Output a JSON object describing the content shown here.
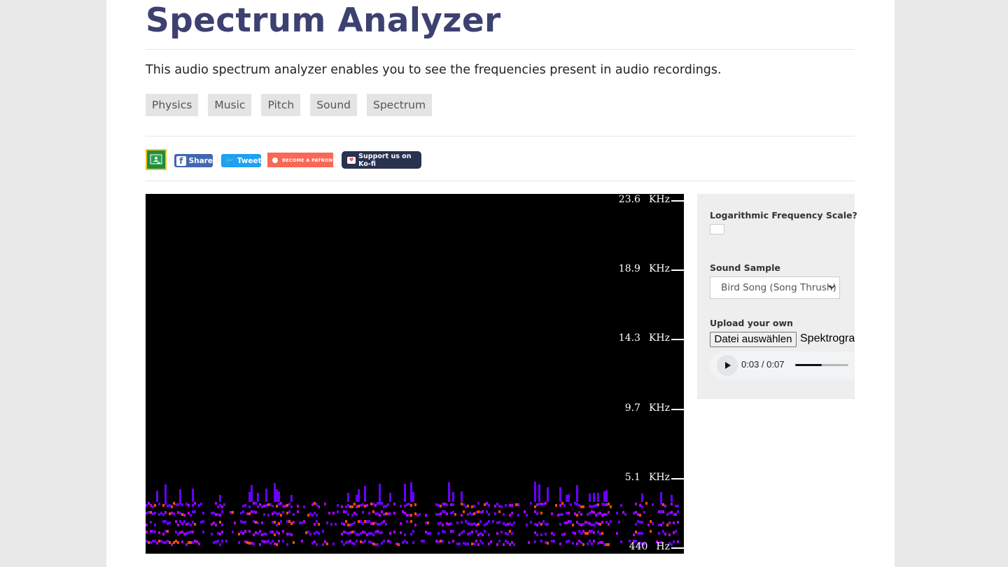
{
  "page": {
    "title": "Spectrum Analyzer",
    "description": "This audio spectrum analyzer enables you to see the frequencies present in audio recordings.",
    "tags": [
      "Physics",
      "Music",
      "Pitch",
      "Sound",
      "Spectrum"
    ]
  },
  "share": {
    "classroom_icon": "google-classroom-icon",
    "facebook_label": "Share",
    "twitter_label": "Tweet",
    "patreon_label": "BECOME A PATRON",
    "kofi_label": "Support us on Ko-fi"
  },
  "spectrogram": {
    "frequency_labels": [
      {
        "value": "23.6",
        "unit": "KHz"
      },
      {
        "value": "18.9",
        "unit": "KHz"
      },
      {
        "value": "14.3",
        "unit": "KHz"
      },
      {
        "value": "9.7",
        "unit": "KHz"
      },
      {
        "value": "5.1",
        "unit": "KHz"
      },
      {
        "value": "440",
        "unit": "Hz"
      }
    ],
    "colors": {
      "background": "#000000",
      "low": "#6a00ff",
      "mid": "#b300ff",
      "high": "#ff4a00"
    }
  },
  "controls": {
    "log_scale_label": "Logarithmic Frequency Scale?",
    "log_scale_checked": false,
    "sound_sample_label": "Sound Sample",
    "sound_sample_selected": "Bird Song (Song Thrush)",
    "upload_label": "Upload your own",
    "file_button_label": "Datei auswählen",
    "file_name": "Spektrogramm",
    "audio": {
      "current_time": "0:03",
      "separator": " / ",
      "duration": "0:07",
      "progress": 0.5
    }
  }
}
